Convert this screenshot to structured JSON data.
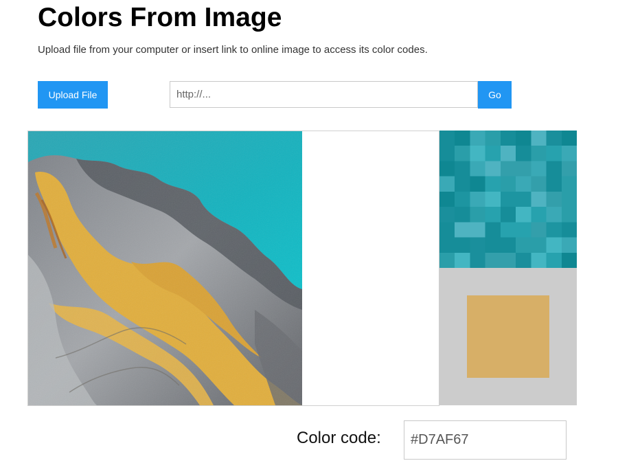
{
  "header": {
    "title": "Colors From Image",
    "subtitle": "Upload file from your computer or insert link to online image to access its color codes."
  },
  "toolbar": {
    "upload_label": "Upload File",
    "url_placeholder": "http://...",
    "url_value": "",
    "go_label": "Go"
  },
  "picker": {
    "code_label": "Color code:",
    "code_value": "#D7AF67",
    "selected_color": "#D7AF67"
  },
  "colors": {
    "accent": "#2196F3",
    "panel_background": "#CCCCCC"
  }
}
